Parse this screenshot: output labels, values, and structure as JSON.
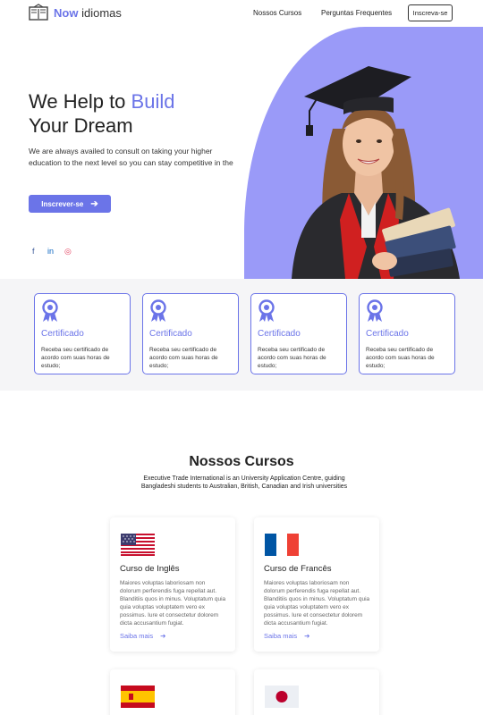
{
  "header": {
    "logo_brand": "Now",
    "logo_rest": "idiomas",
    "nav": [
      "Nossos Cursos",
      "Perguntas Frequentes"
    ],
    "cta_label": "Inscreva-se"
  },
  "hero": {
    "title_part1": "We Help to ",
    "title_accent": "Build",
    "title_part2": "Your Dream",
    "subtitle": "We are always availed to consult on taking your higher education to the next level so you can stay competitive in the",
    "button_label": "Inscrever-se",
    "social_icons": [
      "facebook-icon",
      "linkedin-icon",
      "instagram-icon"
    ],
    "social_glyphs": [
      "f",
      "in",
      "◎"
    ]
  },
  "certificates": [
    {
      "title": "Certificado",
      "desc": "Receba seu certificado de acordo com suas horas de estudo;"
    },
    {
      "title": "Certificado",
      "desc": "Receba seu certificado de acordo com suas horas de estudo;"
    },
    {
      "title": "Certificado",
      "desc": "Receba seu certificado de acordo com suas horas de estudo;"
    },
    {
      "title": "Certificado",
      "desc": "Receba seu certificado de acordo com suas horas de estudo;"
    }
  ],
  "courses": {
    "title": "Nossos Cursos",
    "subtitle": "Executive Trade International is an University Application Centre, guiding Bangladeshi students to Australian, British, Canadian and Irish universities",
    "items": [
      {
        "name": "Curso de Inglês",
        "flag": "usa-flag-icon",
        "desc": "Maiores voluptas laboriosam non dolorum perferendis fuga repellat aut. Blanditiis quos in minus. Voluptatum quia quia voluptas voluptatem vero ex possimus. Iure et consectetur dolorem dicta accusantium fugiat.",
        "link": "Saiba mais"
      },
      {
        "name": "Curso de Francês",
        "flag": "france-flag-icon",
        "desc": "Maiores voluptas laboriosam non dolorum perferendis fuga repellat aut. Blanditiis quos in minus. Voluptatum quia quia voluptas voluptatem vero ex possimus. Iure et consectetur dolorem dicta accusantium fugiat.",
        "link": "Saiba mais"
      },
      {
        "name": "",
        "flag": "spain-flag-icon",
        "desc": "",
        "link": ""
      },
      {
        "name": "",
        "flag": "japan-flag-icon",
        "desc": "",
        "link": ""
      }
    ]
  },
  "colors": {
    "accent": "#6b74e8",
    "hero_blob": "#9a9af8",
    "band_bg": "#f5f5f7"
  }
}
